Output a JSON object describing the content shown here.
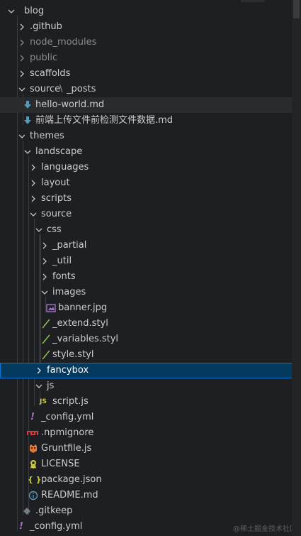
{
  "tree": {
    "root": {
      "label": "blog"
    },
    "items": {
      "github": "github_label",
      "github_label": ".github",
      "node_modules_label": "node_modules",
      "public_label": "public",
      "scaffolds_label": "scaffolds",
      "source_label": "source",
      "source_sep": "\\",
      "posts_label": "_posts",
      "hello_label": "hello-world.md",
      "qianduan_label": "前端上传文件前检测文件数据.md",
      "themes_label": "themes",
      "landscape_label": "landscape",
      "languages_label": "languages",
      "layout_label": "layout",
      "scripts_label": "scripts",
      "theme_source_label": "source",
      "css_label": "css",
      "partial_label": "_partial",
      "util_label": "_util",
      "fonts_label": "fonts",
      "images_label": "images",
      "banner_label": "banner.jpg",
      "extend_label": "_extend.styl",
      "variables_label": "_variables.styl",
      "style_label": "style.styl",
      "fancybox_label": "fancybox",
      "js_label": "js",
      "scriptjs_label": "script.js",
      "theme_config_label": "_config.yml",
      "npmignore_label": ".npmignore",
      "gruntfile_label": "Gruntfile.js",
      "license_label": "LICENSE",
      "packagejson_label": "package.json",
      "readme_label": "README.md",
      "gitkeep_label": ".gitkeep",
      "root_config_label": "_config.yml"
    },
    "badges": {
      "js_badge": "JS",
      "json_badge": "{ }",
      "exclaim": "!"
    }
  },
  "watermark": "@稀土掘金技术社区",
  "colors": {
    "background": "#1e1f22",
    "selected_bg": "#04395e",
    "selected_border": "#0078d4",
    "md_icon": "#519aba",
    "yml_icon": "#a074c4",
    "js_icon": "#cbcb41",
    "styl_icon": "#8dc149",
    "grunt_icon": "#e37933",
    "npm_icon": "#cc3e44",
    "license_icon": "#cbcb41",
    "readme_icon": "#519aba",
    "dim_text": "#8b8b8b"
  }
}
